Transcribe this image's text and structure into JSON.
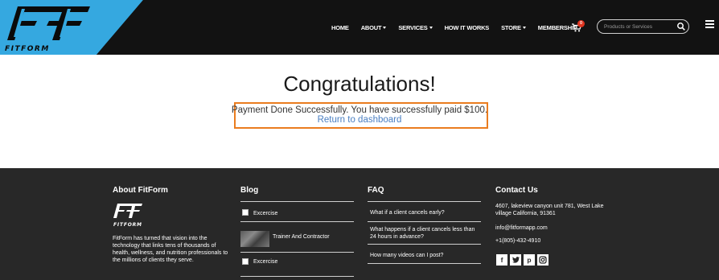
{
  "header": {
    "logo_text": "FitForm",
    "nav": [
      {
        "label": "HOME",
        "has_caret": false
      },
      {
        "label": "ABOUT",
        "has_caret": true
      },
      {
        "label": "SERVICES",
        "has_caret": true
      },
      {
        "label": "HOW IT WORKS",
        "has_caret": false
      },
      {
        "label": "STORE",
        "has_caret": true
      },
      {
        "label": "MEMBERSHIP",
        "has_caret": false
      }
    ],
    "cart_count": "0",
    "search_placeholder": "Products or Services",
    "icons": [
      "cart-icon",
      "search-icon",
      "hamburger-menu-icon"
    ]
  },
  "main": {
    "title": "Congratulations!",
    "message": "Payment Done Successfully. You have successfully paid $100.",
    "return_link": "Return to dashboard",
    "highlight_color": "#ea7c1f",
    "link_color": "#4a7fc2"
  },
  "footer": {
    "about": {
      "heading": "About FitForm",
      "logo_text": "FitForm",
      "text": "FitForm has turned that vision into the technology that links tens of thousands of health, wellness, and nutrition professionals to the millions of clients they serve."
    },
    "blog": {
      "heading": "Blog",
      "items": [
        "Excercise",
        "Trainer And Contractor",
        "Excercise"
      ]
    },
    "faq": {
      "heading": "FAQ",
      "items": [
        "What if a client cancels early?",
        "What happens if a client cancels less than 24 hours in advance?",
        "How many videos can I post?"
      ]
    },
    "contact": {
      "heading": "Contact Us",
      "address": "4607, lakeview canyon unit 781, West Lake village California, 91361",
      "email": "info@fitformapp.com",
      "phone": "+1(805)-432-4910",
      "social": [
        "facebook-icon",
        "twitter-icon",
        "pinterest-icon",
        "instagram-icon"
      ]
    }
  }
}
